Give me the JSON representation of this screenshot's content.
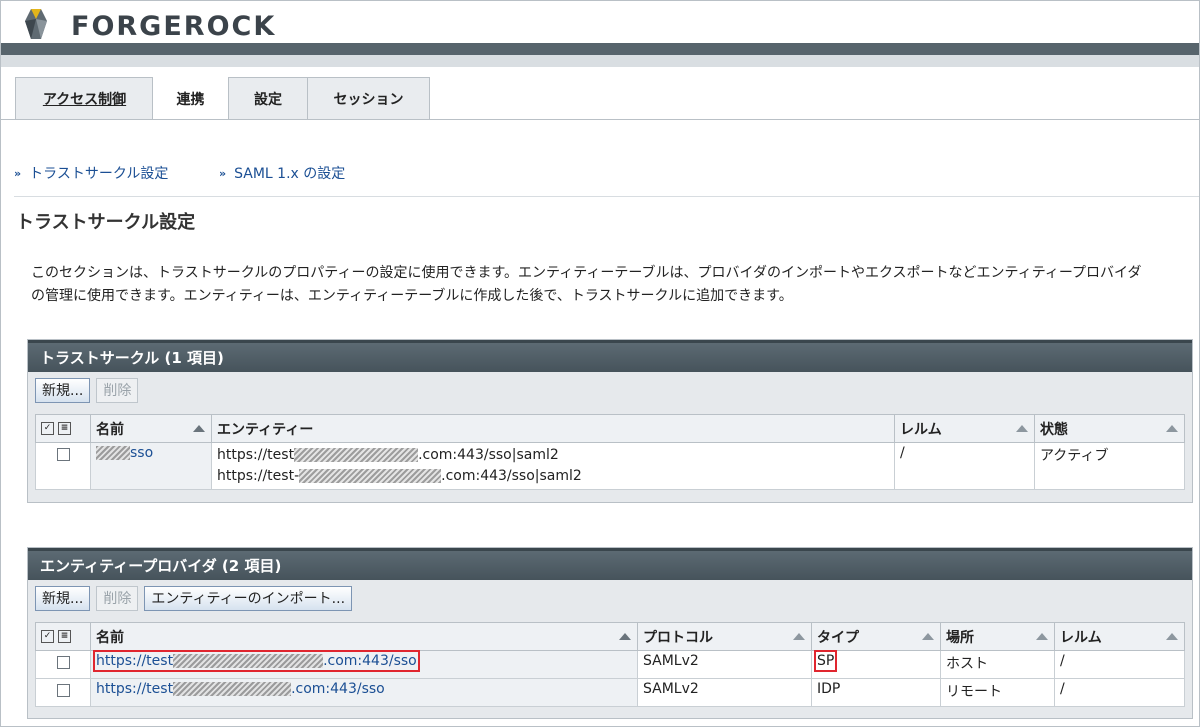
{
  "brand": {
    "name": "FORGEROCK"
  },
  "tabs": [
    {
      "label": "アクセス制御"
    },
    {
      "label": "連携"
    },
    {
      "label": "設定"
    },
    {
      "label": "セッション"
    }
  ],
  "jump_links": [
    {
      "label": "トラストサークル設定"
    },
    {
      "label": "SAML 1.x の設定"
    }
  ],
  "section": {
    "title": "トラストサークル設定",
    "description_line1": "このセクションは、トラストサークルのプロパティーの設定に使用できます。エンティティーテーブルは、プロバイダのインポートやエクスポートなどエンティティープロバイダ",
    "description_line2": "の管理に使用できます。エンティティーは、エンティティーテーブルに作成した後で、トラストサークルに追加できます。"
  },
  "cot_panel": {
    "title": "トラストサークル (1 項目)",
    "buttons": {
      "new": "新規...",
      "delete": "削除"
    },
    "columns": [
      "名前",
      "エンティティー",
      "レルム",
      "状態"
    ],
    "rows": [
      {
        "name_suffix": "sso",
        "entity1_prefix": "https://test",
        "entity1_suffix": ".com:443/sso|saml2",
        "entity2_prefix": "https://test-",
        "entity2_suffix": ".com:443/sso|saml2",
        "realm": "/",
        "status": "アクティブ"
      }
    ]
  },
  "entity_panel": {
    "title": "エンティティープロバイダ (2 項目)",
    "buttons": {
      "new": "新規...",
      "delete": "削除",
      "import": "エンティティーのインポート..."
    },
    "columns": [
      "名前",
      "プロトコル",
      "タイプ",
      "場所",
      "レルム"
    ],
    "rows": [
      {
        "name_prefix": "https://test",
        "name_suffix": ".com:443/sso",
        "protocol": "SAMLv2",
        "type": "SP",
        "location": "ホスト",
        "realm": "/"
      },
      {
        "name_prefix": "https://test",
        "name_suffix": ".com:443/sso",
        "protocol": "SAMLv2",
        "type": "IDP",
        "location": "リモート",
        "realm": "/"
      }
    ]
  },
  "colors": {
    "accent_link": "#1b4f94",
    "panel_header": "#4f5c64",
    "highlight": "#e0262f"
  }
}
